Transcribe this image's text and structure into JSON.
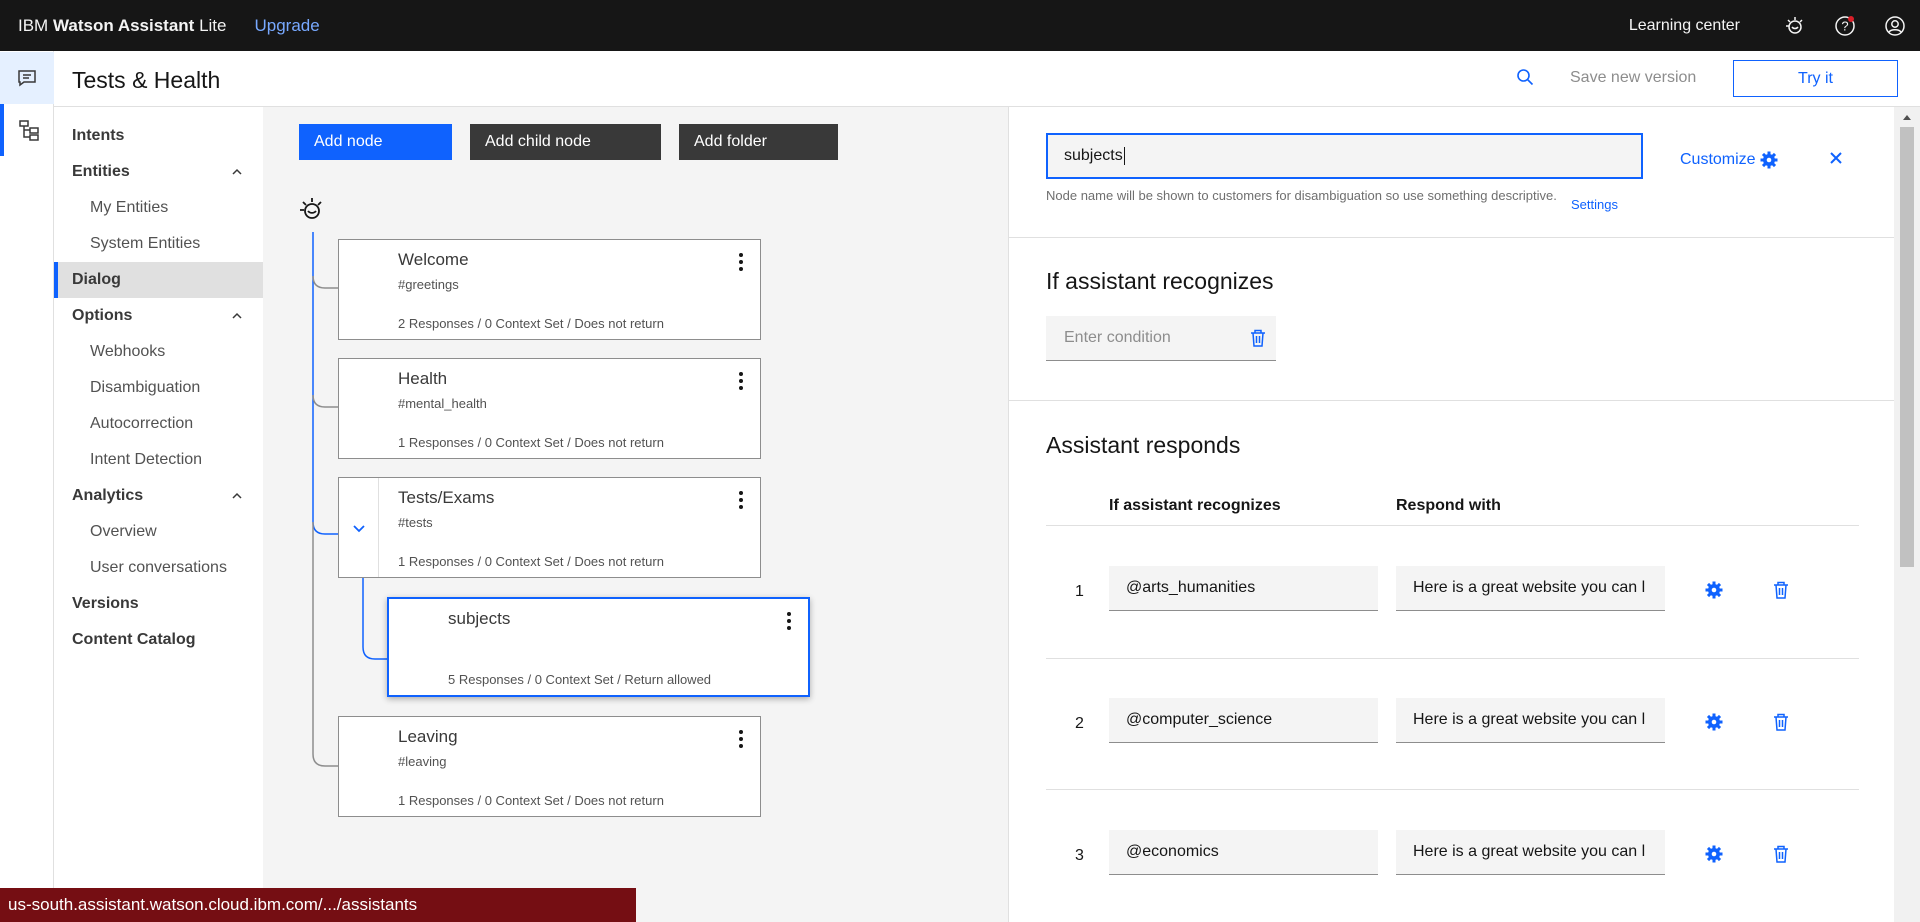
{
  "topbar": {
    "brand_prefix": "IBM",
    "brand_product": "Watson Assistant",
    "brand_plan": "Lite",
    "upgrade": "Upgrade",
    "learning_center": "Learning center",
    "icons": [
      "watson-icon",
      "help-icon",
      "user-icon"
    ]
  },
  "rail": {
    "icons": [
      "chat-icon",
      "skills-icon"
    ]
  },
  "header": {
    "title": "Tests & Health",
    "save_version": "Save new version",
    "try_it": "Try it"
  },
  "nav": {
    "intents": "Intents",
    "entities": "Entities",
    "my_entities": "My Entities",
    "system_entities": "System Entities",
    "dialog": "Dialog",
    "options": "Options",
    "webhooks": "Webhooks",
    "disambiguation": "Disambiguation",
    "autocorrection": "Autocorrection",
    "intent_detection": "Intent Detection",
    "analytics": "Analytics",
    "overview": "Overview",
    "user_conversations": "User conversations",
    "versions": "Versions",
    "content_catalog": "Content Catalog"
  },
  "toolbar": {
    "add_node": "Add node",
    "add_child_node": "Add child node",
    "add_folder": "Add folder"
  },
  "nodes": [
    {
      "title": "Welcome",
      "intent": "#greetings",
      "summary": "2 Responses / 0 Context Set / Does not return"
    },
    {
      "title": "Health",
      "intent": "#mental_health",
      "summary": "1 Responses / 0 Context Set / Does not return"
    },
    {
      "title": "Tests/Exams",
      "intent": "#tests",
      "summary": "1 Responses / 0 Context Set / Does not return"
    },
    {
      "title": "subjects",
      "intent": "",
      "summary": "5 Responses / 0 Context Set / Return allowed"
    },
    {
      "title": "Leaving",
      "intent": "#leaving",
      "summary": "1 Responses / 0 Context Set / Does not return"
    }
  ],
  "panel": {
    "node_name": "subjects",
    "customize": "Customize",
    "help_text": "Node name will be shown to customers for disambiguation so use something descriptive.",
    "settings": "Settings",
    "if_recognizes_heading": "If assistant recognizes",
    "condition_placeholder": "Enter condition",
    "responds_heading": "Assistant responds",
    "col_recognizes": "If assistant recognizes",
    "col_respond": "Respond with",
    "rows": [
      {
        "num": "1",
        "condition": "@arts_humanities",
        "response": "Here is a great website you can l"
      },
      {
        "num": "2",
        "condition": "@computer_science",
        "response": "Here is a great website you can l"
      },
      {
        "num": "3",
        "condition": "@economics",
        "response": "Here is a great website you can l"
      }
    ]
  },
  "status_url": "us-south.assistant.watson.cloud.ibm.com/.../assistants",
  "colors": {
    "accent": "#0f62fe",
    "topbar": "#161616",
    "status": "#750e13"
  }
}
